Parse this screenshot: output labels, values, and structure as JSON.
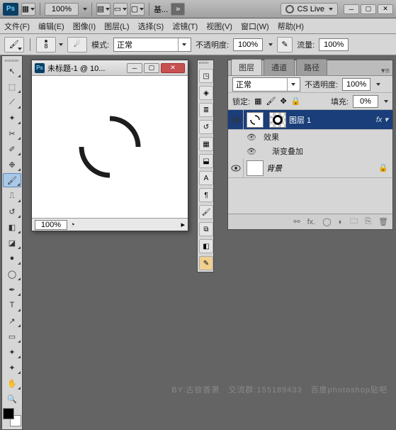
{
  "app": {
    "brand": "Ps",
    "cslive": "CS Live",
    "zoom_top": "100%",
    "essentials": "基..."
  },
  "menu": [
    "文件(F)",
    "编辑(E)",
    "图像(I)",
    "图层(L)",
    "选择(S)",
    "滤镜(T)",
    "视图(V)",
    "窗口(W)",
    "帮助(H)"
  ],
  "options": {
    "brush_size": "8",
    "mode_label": "模式:",
    "mode_value": "正常",
    "opacity_label": "不透明度:",
    "opacity_value": "100%",
    "flow_label": "流量:",
    "flow_value": "100%"
  },
  "doc": {
    "title": "未标题-1 @ 10...",
    "status_zoom": "100%"
  },
  "panel": {
    "tabs": [
      "图层",
      "通道",
      "路径"
    ],
    "blend": "正常",
    "opacity_label": "不透明度:",
    "opacity_value": "100%",
    "lock_label": "锁定:",
    "fill_label": "填充:",
    "fill_value": "0%",
    "layers": [
      {
        "name": "图层 1",
        "active": true,
        "hasMask": true
      },
      {
        "name": "背景",
        "active": false,
        "hasMask": false
      }
    ],
    "fx_label": "效果",
    "fx_item": "渐变叠加",
    "foot_fx": "fx."
  },
  "watermark": "BY:古欲香萧　交流群:155189433　百度photoshop贴吧"
}
